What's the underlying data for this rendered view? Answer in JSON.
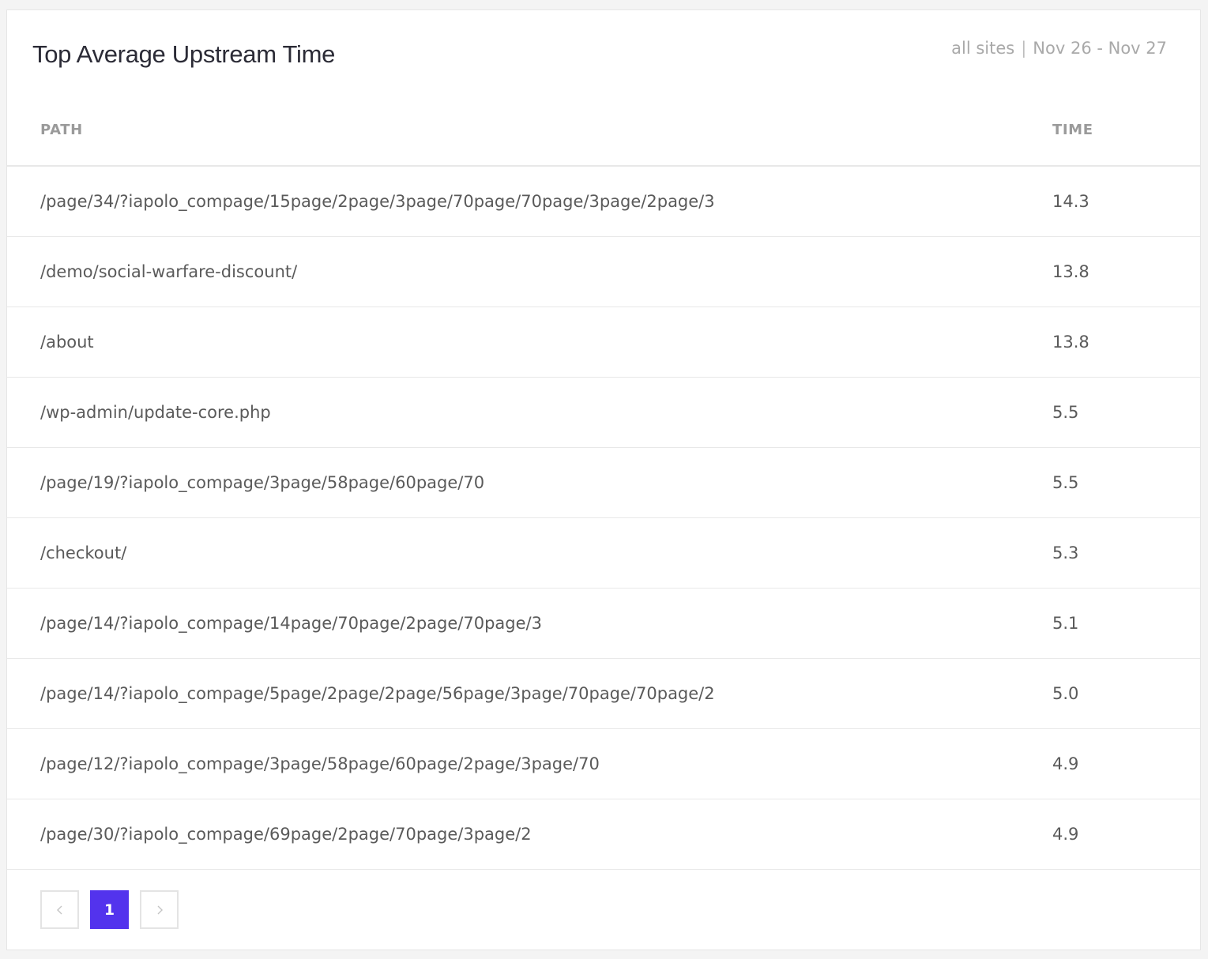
{
  "card": {
    "title": "Top Average Upstream Time",
    "scope": "all sites",
    "separator": "|",
    "date_range": "Nov 26 - Nov 27"
  },
  "table": {
    "headers": {
      "path": "PATH",
      "time": "TIME"
    },
    "rows": [
      {
        "path": "/page/34/?iapolo_compage/15page/2page/3page/70page/70page/3page/2page/3",
        "time": "14.3"
      },
      {
        "path": "/demo/social-warfare-discount/",
        "time": "13.8"
      },
      {
        "path": "/about",
        "time": "13.8"
      },
      {
        "path": "/wp-admin/update-core.php",
        "time": "5.5"
      },
      {
        "path": "/page/19/?iapolo_compage/3page/58page/60page/70",
        "time": "5.5"
      },
      {
        "path": "/checkout/",
        "time": "5.3"
      },
      {
        "path": "/page/14/?iapolo_compage/14page/70page/2page/70page/3",
        "time": "5.1"
      },
      {
        "path": "/page/14/?iapolo_compage/5page/2page/2page/56page/3page/70page/70page/2",
        "time": "5.0"
      },
      {
        "path": "/page/12/?iapolo_compage/3page/58page/60page/2page/3page/70",
        "time": "4.9"
      },
      {
        "path": "/page/30/?iapolo_compage/69page/2page/70page/3page/2",
        "time": "4.9"
      }
    ]
  },
  "pagination": {
    "current_page": "1",
    "prev_icon": "chevron-left-icon",
    "next_icon": "chevron-right-icon",
    "active_color": "#5333ed"
  }
}
